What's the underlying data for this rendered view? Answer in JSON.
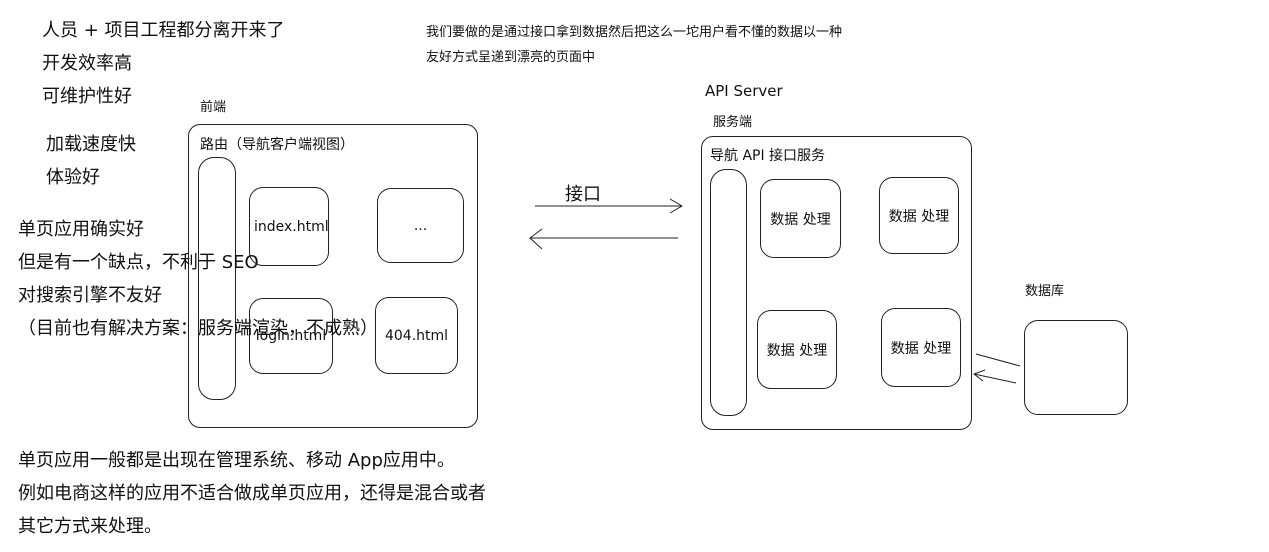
{
  "notes_left": {
    "line1": "人员 + 项目工程都分离开来了",
    "line2": "开发效率高",
    "line3": "可维护性好",
    "line4": "加载速度快",
    "line5": "体验好"
  },
  "spa_pros": {
    "line1": "单页应用确实好",
    "line2": "但是有一个缺点，不利于 SEO",
    "line3": "对搜索引擎不友好",
    "line4": "（目前也有解决方案：服务端渲染，不成熟）"
  },
  "bottom_notes": {
    "line1": "单页应用一般都是出现在管理系统、移动 App应用中。",
    "line2": "例如电商这样的应用不适合做成单页应用，还得是混合或者",
    "line3": "其它方式来处理。"
  },
  "top_note": {
    "line1": "我们要做的是通过接口拿到数据然后把这么一坨用户看不懂的数据以一种",
    "line2": "友好方式呈递到漂亮的页面中"
  },
  "frontend": {
    "label": "前端",
    "router_label": "路由（导航客户端视图）",
    "pages": [
      "index.html",
      "...",
      "login.html",
      "404.html"
    ]
  },
  "interface": {
    "label": "接口"
  },
  "server": {
    "title": "API Server",
    "label": "服务端",
    "nav_label": "导航 API 接口服务",
    "handlers": [
      "数据 处理",
      "数据 处理",
      "数据 处理",
      "数据 处理"
    ]
  },
  "database": {
    "label": "数据库"
  }
}
